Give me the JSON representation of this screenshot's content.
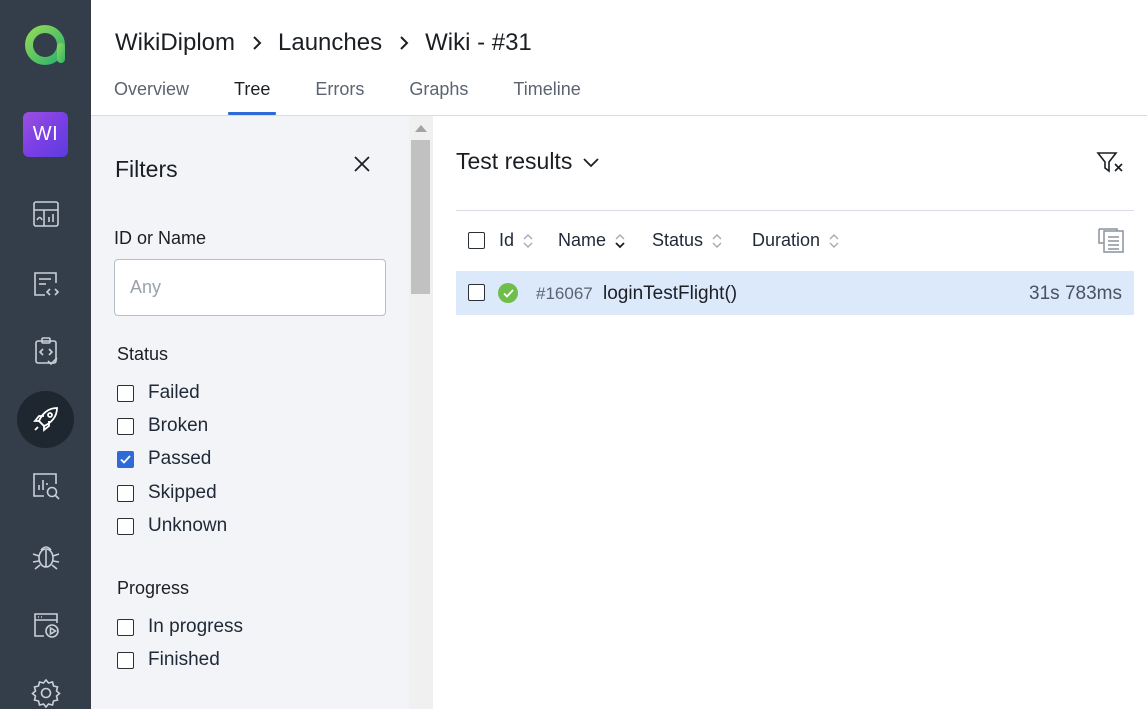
{
  "rail": {
    "project_initials": "WI",
    "accent": "#6fbe4a",
    "icons": [
      "dashboards-icon",
      "test-cases-icon",
      "test-plans-icon",
      "launches-icon",
      "analytics-icon",
      "defects-icon",
      "jobs-icon",
      "settings-icon"
    ]
  },
  "breadcrumb": [
    "WikiDiplom",
    "Launches",
    "Wiki - #31"
  ],
  "tabs": [
    {
      "label": "Overview",
      "active": false
    },
    {
      "label": "Tree",
      "active": true
    },
    {
      "label": "Errors",
      "active": false
    },
    {
      "label": "Graphs",
      "active": false
    },
    {
      "label": "Timeline",
      "active": false
    }
  ],
  "filters": {
    "title": "Filters",
    "id_or_name_label": "ID or Name",
    "id_or_name_placeholder": "Any",
    "status_title": "Status",
    "status_options": [
      {
        "label": "Failed",
        "checked": false
      },
      {
        "label": "Broken",
        "checked": false
      },
      {
        "label": "Passed",
        "checked": true
      },
      {
        "label": "Skipped",
        "checked": false
      },
      {
        "label": "Unknown",
        "checked": false
      }
    ],
    "progress_title": "Progress",
    "progress_options": [
      {
        "label": "In progress",
        "checked": false
      },
      {
        "label": "Finished",
        "checked": false
      }
    ]
  },
  "results": {
    "title": "Test results",
    "columns": [
      "Id",
      "Name",
      "Status",
      "Duration"
    ],
    "rows": [
      {
        "id": "#16067",
        "name": "loginTestFlight()",
        "status": "passed",
        "duration": "31s 783ms"
      }
    ]
  },
  "colors": {
    "rail_bg": "#343e4a",
    "tab_active": "#2f6ad9",
    "row_selected": "#dce9fb",
    "passed": "#6fbe4a"
  }
}
